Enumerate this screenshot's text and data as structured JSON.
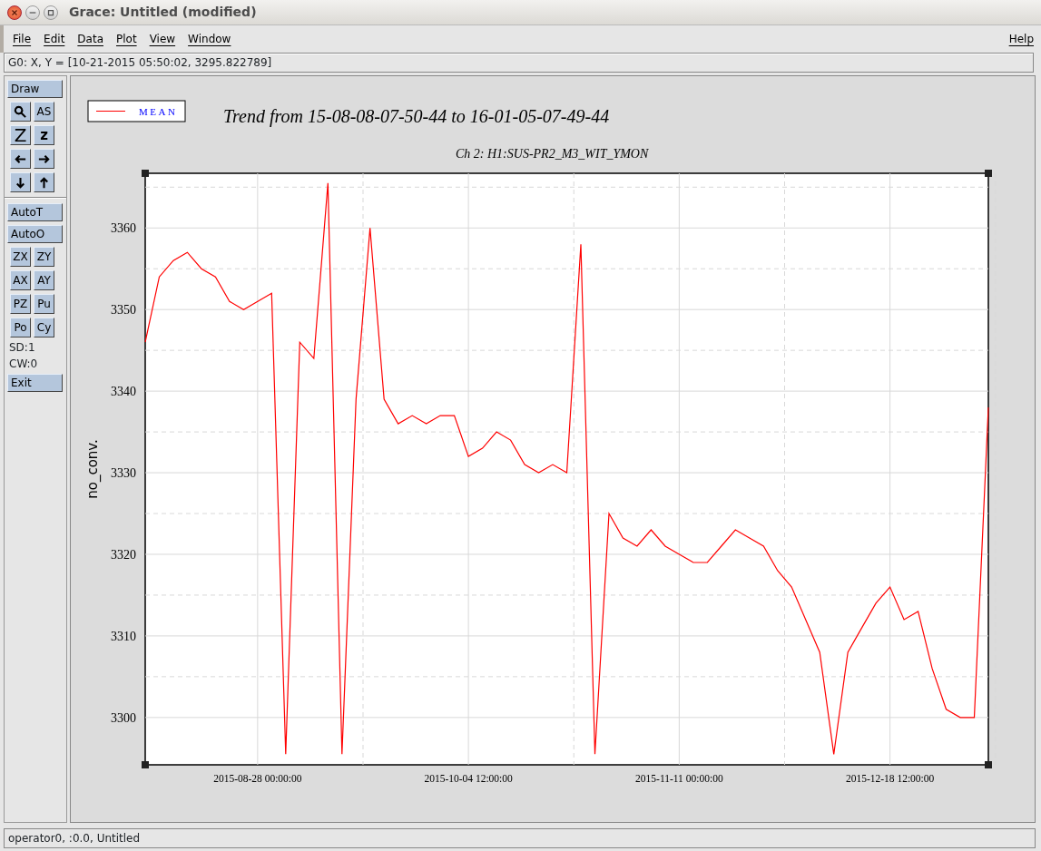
{
  "window": {
    "title": "Grace: Untitled (modified)"
  },
  "menu": {
    "left": [
      {
        "label": "File"
      },
      {
        "label": "Edit"
      },
      {
        "label": "Data"
      },
      {
        "label": "Plot"
      },
      {
        "label": "View"
      },
      {
        "label": "Window"
      }
    ],
    "right": [
      {
        "label": "Help"
      }
    ]
  },
  "locator": "G0: X, Y = [10-21-2015 05:50:02, 3295.822789]",
  "toolbar": [
    {
      "kind": "wide",
      "label": "Draw"
    },
    {
      "kind": "pair",
      "items": [
        {
          "kind": "magnifier"
        },
        {
          "kind": "text",
          "label": "AS"
        }
      ]
    },
    {
      "kind": "pair",
      "items": [
        {
          "kind": "text",
          "label": "Z",
          "big": true
        },
        {
          "kind": "text",
          "label": "z",
          "big": false
        }
      ]
    },
    {
      "kind": "pair",
      "items": [
        {
          "kind": "leftarrow"
        },
        {
          "kind": "rightarrow"
        }
      ]
    },
    {
      "kind": "pair",
      "items": [
        {
          "kind": "downarrow"
        },
        {
          "kind": "uparrow"
        }
      ]
    },
    {
      "kind": "divider"
    },
    {
      "kind": "wide",
      "label": "AutoT"
    },
    {
      "kind": "wide",
      "label": "AutoO"
    },
    {
      "kind": "pair",
      "items": [
        {
          "kind": "text",
          "label": "ZX"
        },
        {
          "kind": "text",
          "label": "ZY"
        }
      ]
    },
    {
      "kind": "pair",
      "items": [
        {
          "kind": "text",
          "label": "AX"
        },
        {
          "kind": "text",
          "label": "AY"
        }
      ]
    },
    {
      "kind": "pair",
      "items": [
        {
          "kind": "text",
          "label": "PZ"
        },
        {
          "kind": "text",
          "label": "Pu"
        }
      ]
    },
    {
      "kind": "pair",
      "items": [
        {
          "kind": "text",
          "label": "Po"
        },
        {
          "kind": "text",
          "label": "Cy"
        }
      ]
    },
    {
      "kind": "info",
      "label": "SD:1"
    },
    {
      "kind": "info",
      "label": "CW:0"
    },
    {
      "kind": "wide",
      "label": "Exit"
    }
  ],
  "plot": {
    "chart_data": {
      "type": "line",
      "title": "Trend from 15-08-08-07-50-44 to 16-01-05-07-49-44",
      "subtitle": "Ch 2: H1:SUS-PR2_M3_WIT_YMON",
      "ylabel": "no_conv.",
      "categories": [
        null,
        null,
        null,
        null,
        null,
        null,
        null,
        null,
        "2015-08-28 00:00:00",
        null,
        null,
        null,
        null,
        null,
        null,
        null,
        null,
        null,
        null,
        null,
        null,
        null,
        null,
        "2015-10-04 12:00:00",
        null,
        null,
        null,
        null,
        null,
        null,
        null,
        null,
        null,
        null,
        null,
        null,
        null,
        null,
        "2015-11-11 00:00:00",
        null,
        null,
        null,
        null,
        null,
        null,
        null,
        null,
        null,
        null,
        null,
        null,
        null,
        null,
        "2015-12-18 12:00:00",
        null,
        null,
        null,
        null,
        null,
        null,
        null
      ],
      "series": [
        {
          "name": "MEAN",
          "color": "#ff0000",
          "values": [
            3346,
            3354,
            3356,
            3357,
            3355,
            3354,
            3351,
            3350,
            3351,
            3352,
            3295.5,
            3346,
            3344,
            3365.5,
            3295.5,
            3339,
            3360,
            3339,
            3336,
            3337,
            3336,
            3337,
            3337,
            3332,
            3333,
            3335,
            3334,
            3331,
            3330,
            3331,
            3330,
            3358,
            3295.5,
            3325,
            3322,
            3321,
            3323,
            3321,
            3320,
            3319,
            3319,
            3321,
            3323,
            3322,
            3321,
            3318,
            3316,
            3312,
            3308,
            3295.5,
            3308,
            3311,
            3314,
            3316,
            3312,
            3313,
            3306,
            3301,
            3300,
            3300,
            3338
          ]
        }
      ],
      "grid": true,
      "ylim": [
        3294.2,
        3366.7
      ],
      "yticks": [
        3300,
        3310,
        3320,
        3330,
        3340,
        3350,
        3360
      ]
    }
  },
  "status_bar": "operator0, :0.0, Untitled"
}
